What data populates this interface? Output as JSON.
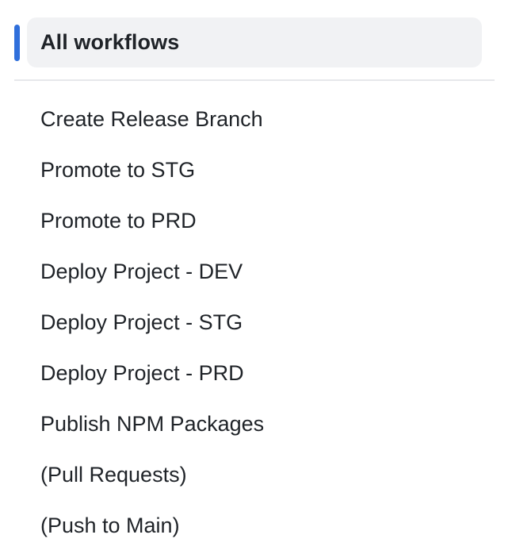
{
  "nav": {
    "active": {
      "label": "All workflows"
    },
    "workflows": [
      {
        "label": "Create Release Branch"
      },
      {
        "label": "Promote to STG"
      },
      {
        "label": "Promote to PRD"
      },
      {
        "label": "Deploy Project - DEV"
      },
      {
        "label": "Deploy Project - STG"
      },
      {
        "label": "Deploy Project - PRD"
      },
      {
        "label": "Publish NPM Packages"
      },
      {
        "label": "(Pull Requests)"
      },
      {
        "label": "(Push to Main)"
      }
    ],
    "colors": {
      "accent": "#2f6fdb",
      "active_background": "#f1f2f4",
      "divider": "#e6e8eb",
      "text": "#1f2328"
    }
  }
}
